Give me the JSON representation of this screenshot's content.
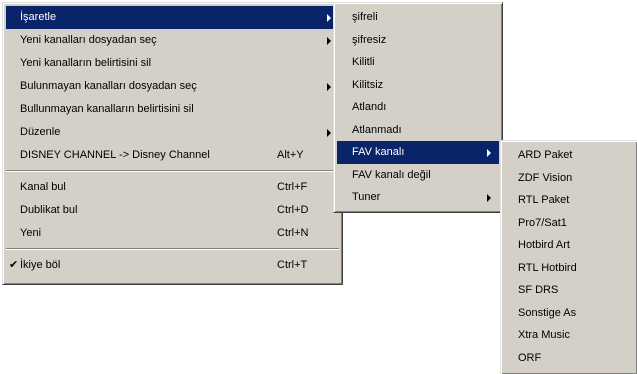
{
  "main_menu": {
    "items": [
      {
        "label": "İşaretle",
        "submenu": true,
        "highlighted": true
      },
      {
        "label": "Yeni kanalları dosyadan seç",
        "submenu": true
      },
      {
        "label": "Yeni kanalların belirtisini sil"
      },
      {
        "label": "Bulunmayan kanalları dosyadan seç",
        "submenu": true
      },
      {
        "label": "Bullunmayan kanalların belirtisini sil"
      },
      {
        "label": "Düzenle",
        "submenu": true
      },
      {
        "label": "DISNEY CHANNEL -> Disney Channel",
        "shortcut": "Alt+Y"
      },
      {
        "label": "Kanal bul",
        "shortcut": "Ctrl+F"
      },
      {
        "label": "Dublikat bul",
        "shortcut": "Ctrl+D"
      },
      {
        "label": "Yeni",
        "shortcut": "Ctrl+N"
      },
      {
        "label": "İkiye böl",
        "shortcut": "Ctrl+T",
        "checked": true
      }
    ],
    "check_glyph": "✔"
  },
  "isaretle_submenu": {
    "items": [
      {
        "label": "şifreli"
      },
      {
        "label": "şifresiz"
      },
      {
        "label": "Kilitli"
      },
      {
        "label": "Kilitsiz"
      },
      {
        "label": "Atlandı"
      },
      {
        "label": "Atlanmadı"
      },
      {
        "label": "FAV kanalı",
        "submenu": true,
        "highlighted": true
      },
      {
        "label": "FAV kanalı değil"
      },
      {
        "label": "Tuner",
        "submenu": true
      }
    ]
  },
  "fav_submenu": {
    "items": [
      {
        "label": "ARD Paket"
      },
      {
        "label": "ZDF Vision"
      },
      {
        "label": "RTL Paket"
      },
      {
        "label": "Pro7/Sat1"
      },
      {
        "label": "Hotbird Art"
      },
      {
        "label": "RTL Hotbird"
      },
      {
        "label": "SF DRS"
      },
      {
        "label": "Sonstige As"
      },
      {
        "label": "Xtra Music"
      },
      {
        "label": "ORF"
      }
    ]
  },
  "colors": {
    "menu_face": "#d4d0c8",
    "highlight": "#0a246a",
    "highlight_text": "#ffffff"
  }
}
